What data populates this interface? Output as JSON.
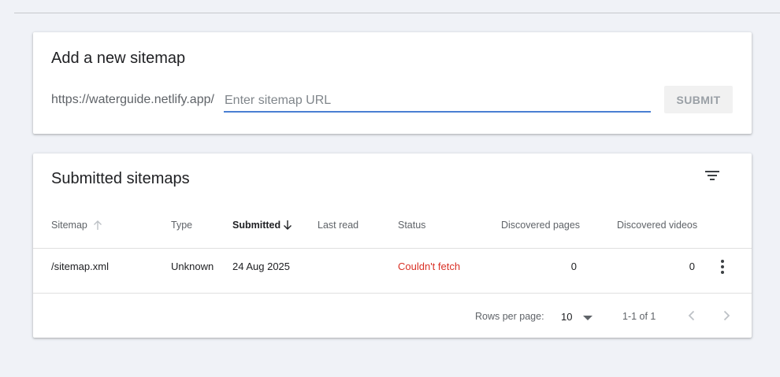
{
  "add_card": {
    "title": "Add a new sitemap",
    "url_prefix": "https://waterguide.netlify.app/",
    "input_value": "",
    "input_placeholder": "Enter sitemap URL",
    "submit_label": "SUBMIT"
  },
  "list_card": {
    "title": "Submitted sitemaps",
    "filter_icon": "filter-icon",
    "columns": [
      "Sitemap",
      "Type",
      "Submitted",
      "Last read",
      "Status",
      "Discovered pages",
      "Discovered videos"
    ],
    "sorted_column": "Submitted",
    "rows": [
      {
        "sitemap": "/sitemap.xml",
        "type": "Unknown",
        "submitted": "24 Aug 2025",
        "last_read": "",
        "status": "Couldn't fetch",
        "discovered_pages": "0",
        "discovered_videos": "0"
      }
    ],
    "footer": {
      "rows_per_page_label": "Rows per page:",
      "rows_per_page_value": "10",
      "range_text": "1-1 of 1"
    }
  },
  "colors": {
    "page_bg": "#f0f2f7",
    "input_underline": "#4a7fd3",
    "status_error": "#d93025"
  }
}
